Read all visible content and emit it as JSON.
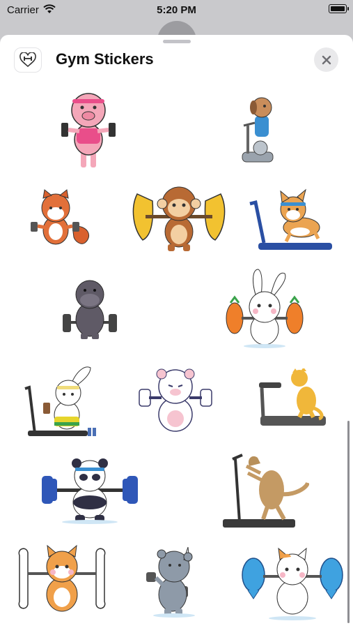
{
  "status_bar": {
    "carrier": "Carrier",
    "time": "5:20 PM",
    "wifi_icon": "wifi-icon",
    "battery_icon": "battery-icon"
  },
  "header": {
    "title": "Gym Stickers",
    "app_icon": "heart-dumbbell-icon",
    "close_icon": "close-icon"
  },
  "stickers": [
    "pig-dumbbells-sticker",
    "dog-exercise-bike-sticker",
    "red-panda-dumbbells-sticker",
    "monkey-banana-barbell-sticker",
    "corgi-treadmill-sticker",
    "hippo-dumbbells-sticker",
    "bunny-carrot-barbell-sticker",
    "bunny-treadmill-sticker",
    "polar-bear-dumbbells-sticker",
    "cat-treadmill-sticker",
    "panda-barbell-sticker",
    "dog-treadmill-sticker",
    "shiba-bone-barbell-sticker",
    "rhino-dumbbells-sticker",
    "cat-fish-barbell-sticker"
  ]
}
